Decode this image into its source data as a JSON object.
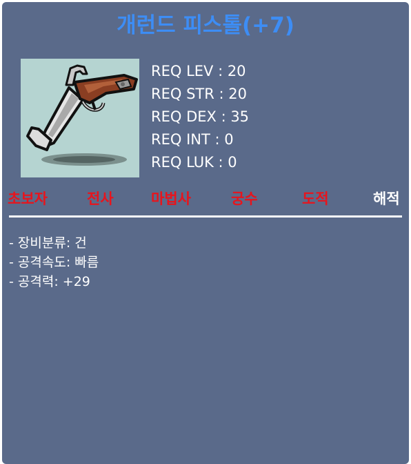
{
  "item": {
    "name": "개런드 피스톨(+7)",
    "icon": "pistol-icon"
  },
  "requirements": [
    "REQ LEV : 20",
    "REQ STR : 20",
    "REQ DEX : 35",
    "REQ INT : 0",
    "REQ LUK : 0"
  ],
  "jobs": [
    {
      "label": "초보자",
      "color": "#e8141c"
    },
    {
      "label": "전사",
      "color": "#e8141c"
    },
    {
      "label": "마법사",
      "color": "#e8141c"
    },
    {
      "label": "궁수",
      "color": "#e8141c"
    },
    {
      "label": "도적",
      "color": "#e8141c"
    },
    {
      "label": "해적",
      "color": "#ffffff"
    }
  ],
  "stats": [
    "- 장비분류: 건",
    "- 공격속도: 빠름",
    "- 공격력: +29"
  ],
  "colors": {
    "title": "#3d8df5",
    "background": "#5a6a8a",
    "icon_background": "#b5d4d1"
  }
}
